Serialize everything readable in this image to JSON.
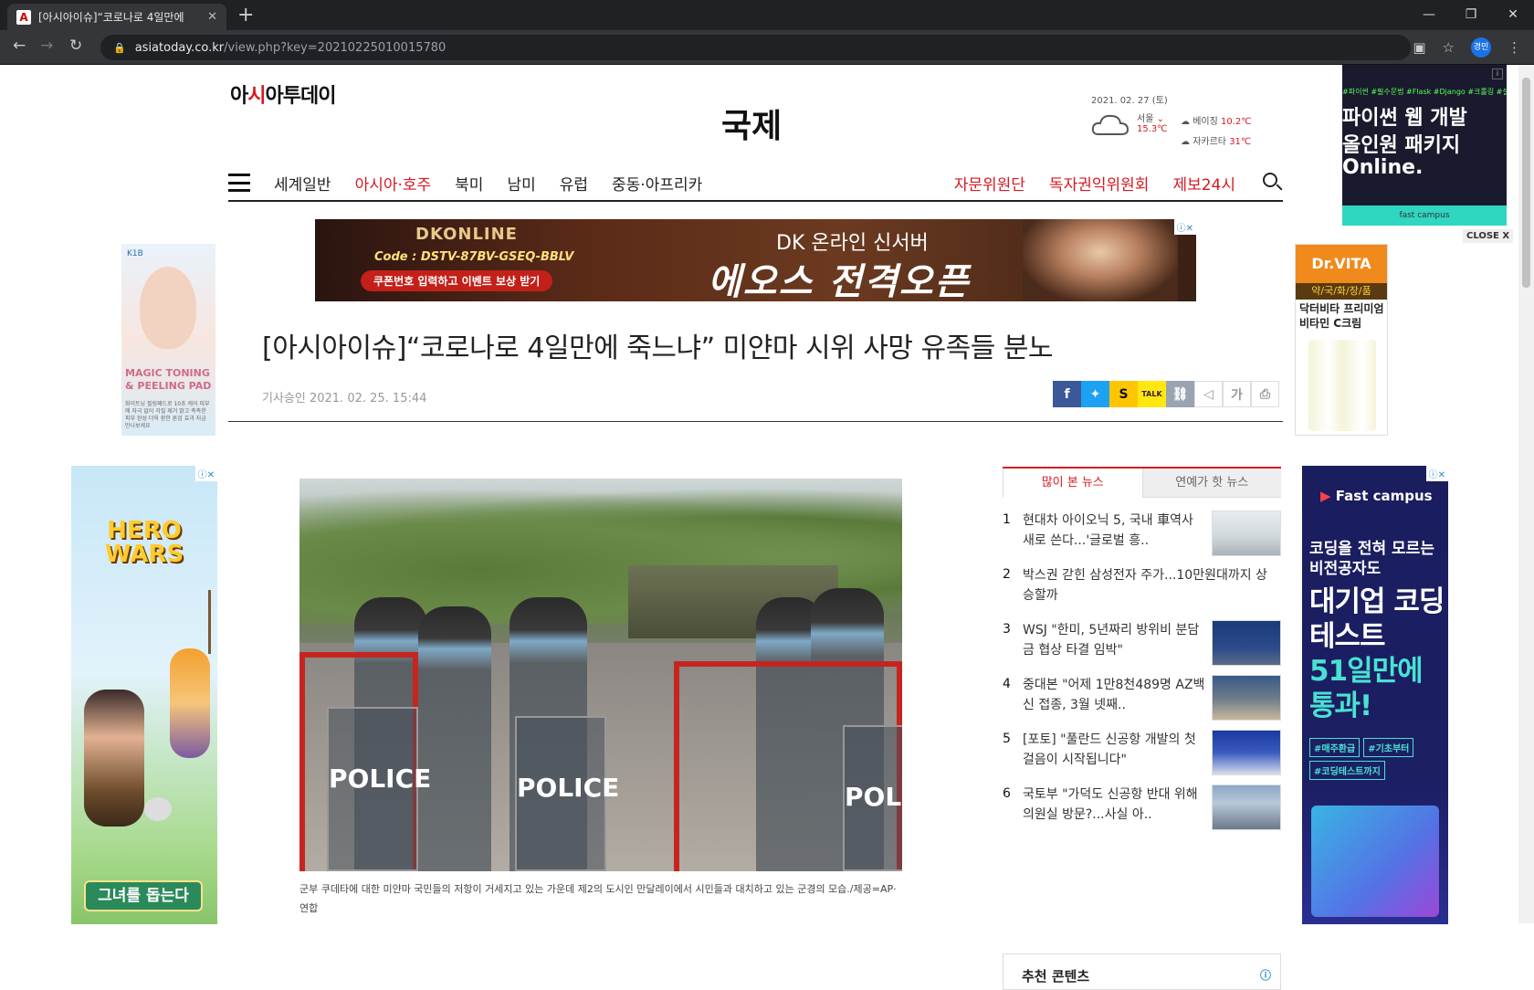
{
  "browser": {
    "tab_title": "[아시아이슈]“코로나로 4일만에",
    "tab_favicon": "A",
    "url_domain": "asiatoday.co.kr",
    "url_rest": "/view.php?key=20210225010015780",
    "profile": "경민"
  },
  "site": {
    "logo_prefix": "아",
    "logo_red": "시",
    "logo_suffix": "아투데이",
    "section": "국제",
    "date": "2021. 02. 27 (토)",
    "weather": {
      "city": "서울",
      "temp": "15.3℃",
      "others": [
        {
          "city": "베이징",
          "temp": "10.2℃"
        },
        {
          "city": "자카르타",
          "temp": "31℃"
        }
      ]
    },
    "nav": [
      "세계일반",
      "아시아·호주",
      "북미",
      "남미",
      "유럽",
      "중동·아프리카"
    ],
    "nav_active_index": 1,
    "nav_right": [
      "자문위원단",
      "독자권익위원회",
      "제보24시"
    ]
  },
  "banner_ad": {
    "brand": "DKONLINE",
    "code": "Code : DSTV-87BV-GSEQ-BBLV",
    "coupon": "쿠폰번호 입력하고 이벤트 보상 받기",
    "server": "DK 온라인 신서버",
    "headline": "에오스 전격오픈"
  },
  "article": {
    "headline": "[아시아이슈]“코로나로 4일만에 죽느냐” 미얀마 시위 사망 유족들 분노",
    "byline": "기사승인 2021. 02. 25. 15:44",
    "caption": "군부 쿠데타에 대한 미얀마 국민들의 저항이 거세지고 있는 가운데 제2의 도시인 만달레이에서 시민들과 대치하고 있는 군경의 모습./제공=AP·연합",
    "photo_shield_text": "POLICE",
    "share": {
      "story": "S",
      "kakao": "TALK",
      "font": "가"
    }
  },
  "sidebar": {
    "tabs": [
      "많이 본 뉴스",
      "연예가 핫 뉴스"
    ],
    "news": [
      {
        "num": "1",
        "title": "현대차 아이오닉 5, 국내 車역사 새로 쓴다...'글로벌 흥..",
        "has_thumb": true
      },
      {
        "num": "2",
        "title": "박스권 갇힌 삼성전자 주가...10만원대까지 상승할까",
        "has_thumb": false
      },
      {
        "num": "3",
        "title": "WSJ \"한미, 5년짜리 방위비 분담금 협상 타결 임박\"",
        "has_thumb": true
      },
      {
        "num": "4",
        "title": "중대본 \"어제 1만8천489명 AZ백신 접종, 3월 넷째..",
        "has_thumb": true
      },
      {
        "num": "5",
        "title": "[포토] \"풀란드 신공항 개발의 첫 걸음이 시작됩니다\"",
        "has_thumb": true
      },
      {
        "num": "6",
        "title": "국토부 \"가덕도 신공항 반대 위해 의원실 방문?...사실 아..",
        "has_thumb": true
      }
    ],
    "recommend": "추천 콘텐츠"
  },
  "ads": {
    "left_top": {
      "brand": "K1B",
      "title": "MAGIC TONING & PEELING PAD",
      "desc": "화이트닝 필링패드로 10초 케어 피부에 자극 없이 각질 제거 맑고 촉촉한 피부 완성 더욱 환한 톤업 효과 지금 만나보세요"
    },
    "right_top": {
      "brand": "Dr.VITA",
      "sub": "약/국/화/장/품",
      "product": "닥터비타 프리미엄 비타민 C크림"
    },
    "left_big": {
      "title": "HERO WARS",
      "button": "그녀를 돕는다"
    },
    "right_big": {
      "brand_mark": "▶",
      "brand_text": "Fast campus",
      "line1": "코딩을 전혀 모르는 비전공자도",
      "line2_a": "대기업 코딩테스트",
      "line2_b": "51일만에 통과!",
      "tags": [
        "#매주환급",
        "#기초부터",
        "#코딩테스트까지"
      ]
    },
    "float": {
      "tags": "#파이썬 #필수문법 #Flask #Django #크롤링 #실전프",
      "lines": [
        "파이썬 웹 개발",
        "올인원 패키지",
        "Online."
      ],
      "footer": "fast campus",
      "badge": "i",
      "close": "CLOSE X"
    }
  }
}
